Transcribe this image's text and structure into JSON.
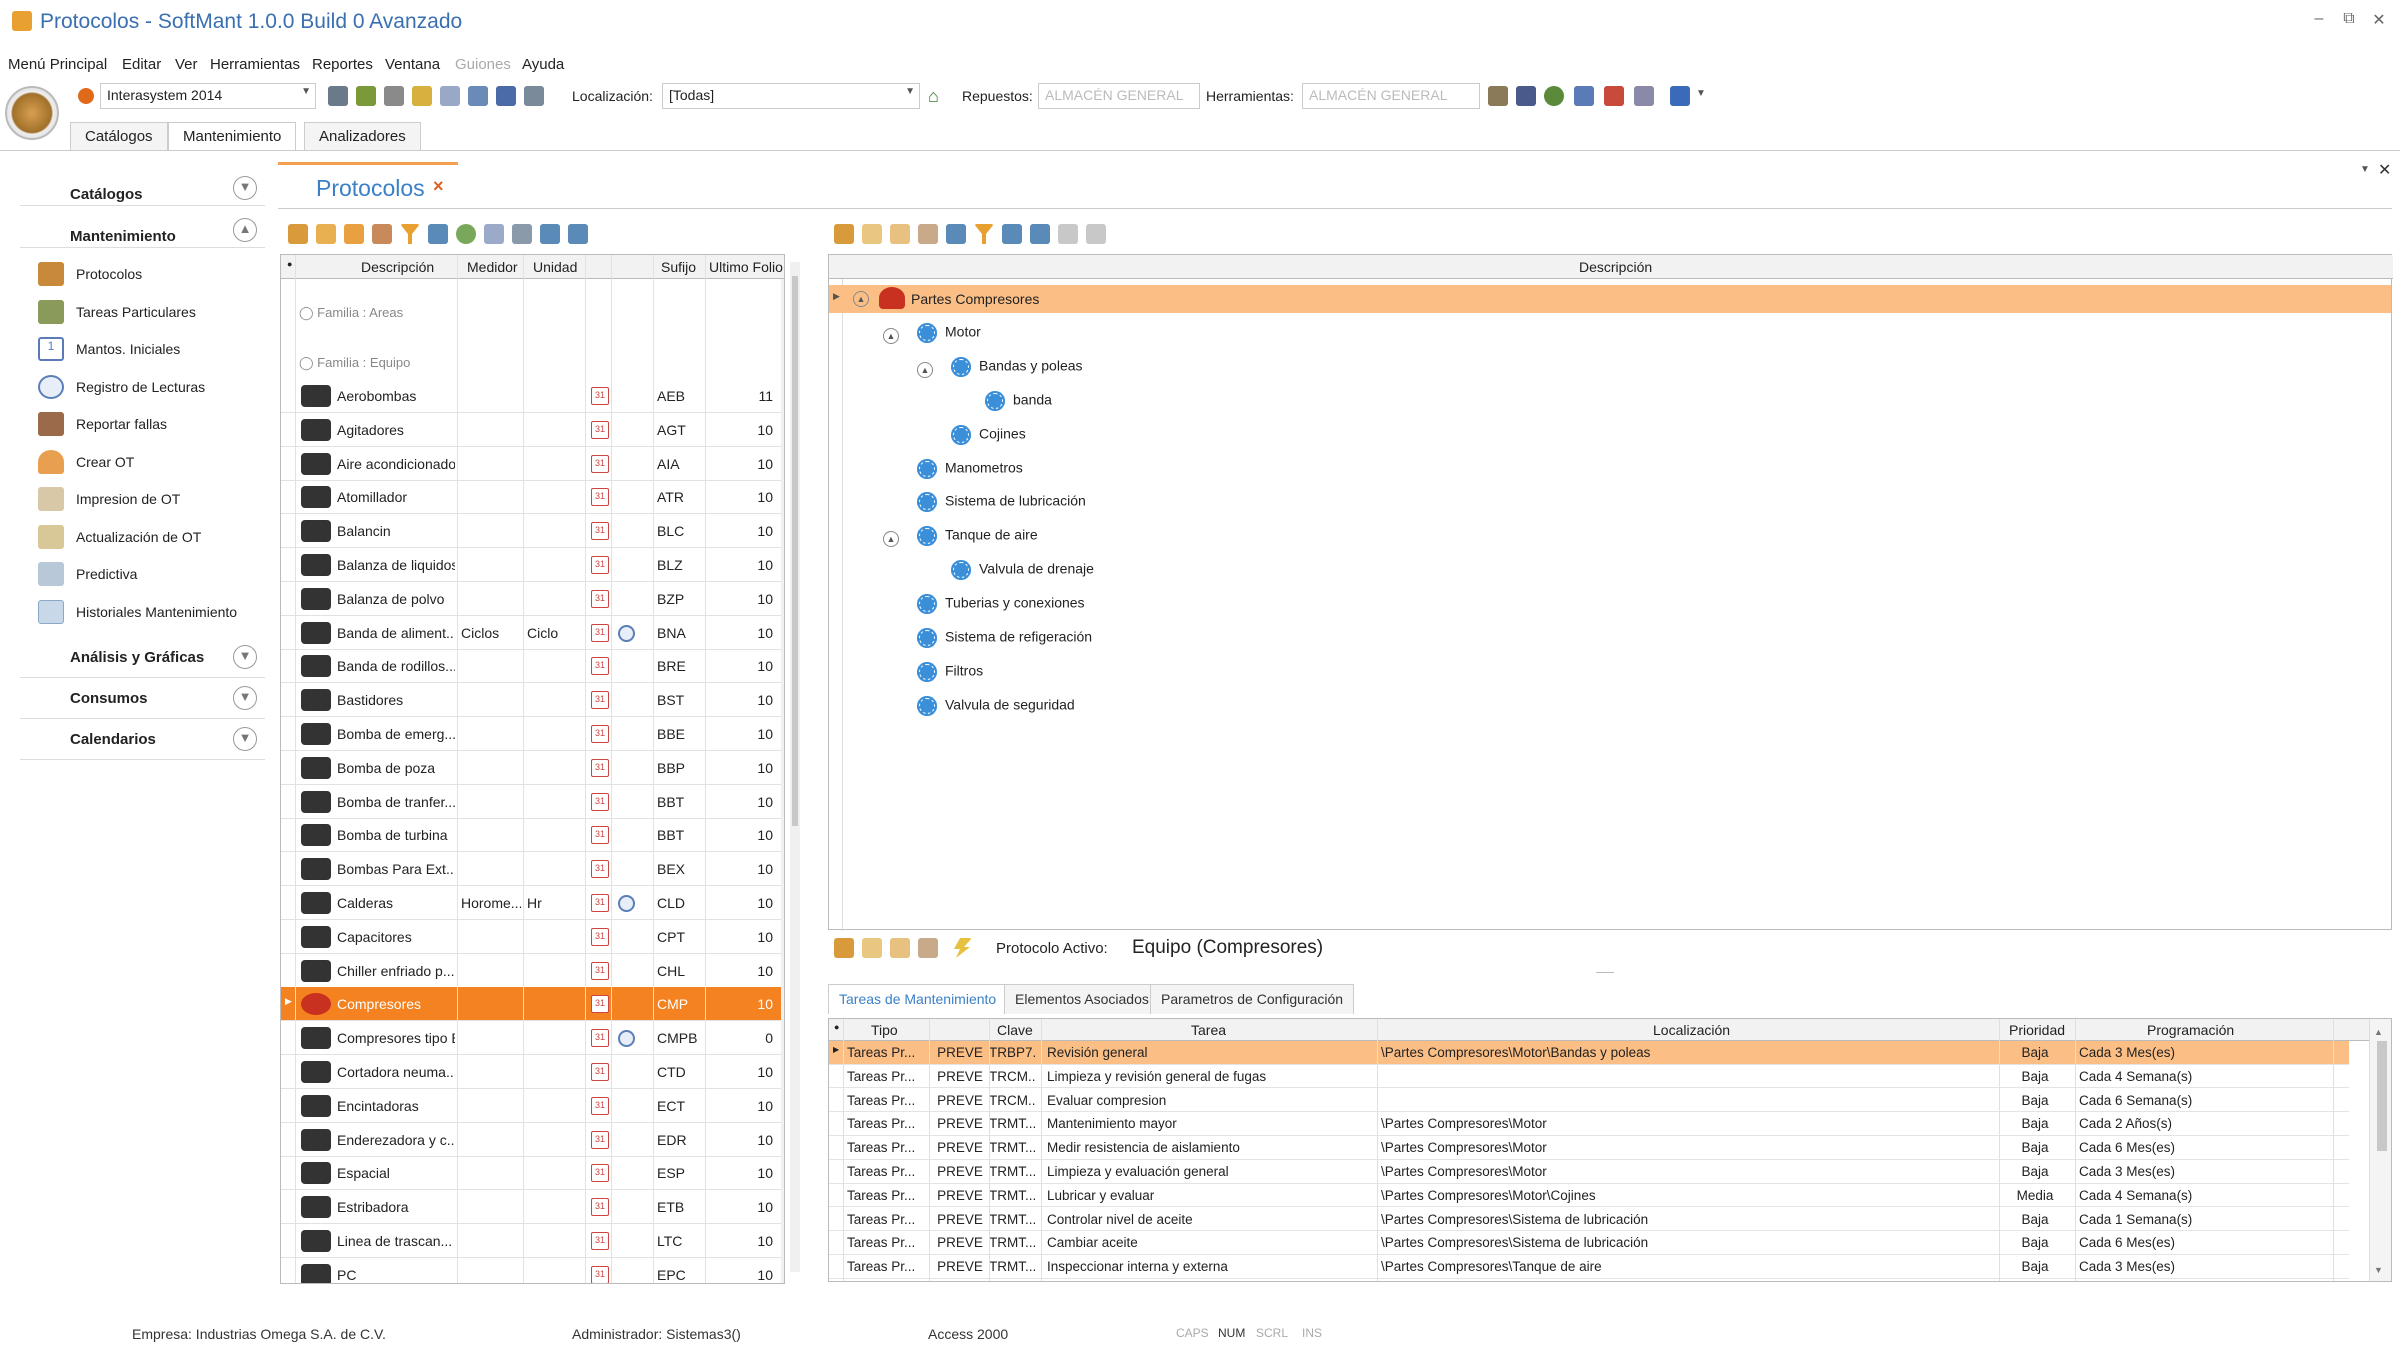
{
  "window": {
    "title": "Protocolos - SoftMant 1.0.0 Build 0 Avanzado",
    "controls": [
      "–",
      "⧉",
      "✕"
    ]
  },
  "menu": [
    "Menú Principal",
    "Editar",
    "Ver",
    "Herramientas",
    "Reportes",
    "Ventana",
    "Guiones",
    "Ayuda"
  ],
  "toolbar": {
    "company_select": "Interasystem 2014",
    "localizacion_label": "Localización:",
    "localizacion_value": "[Todas]",
    "repuestos_label": "Repuestos:",
    "repuestos_value": "ALMACÉN GENERAL",
    "herramientas_label": "Herramientas:",
    "herramientas_value": "ALMACÉN GENERAL"
  },
  "ribbon_tabs": [
    "Catálogos",
    "Mantenimiento",
    "Analizadores"
  ],
  "sidebar": {
    "groups": [
      {
        "label": "Catálogos"
      },
      {
        "label": "Mantenimiento"
      }
    ],
    "items": [
      {
        "label": "Protocolos",
        "icon": "protocol-icon"
      },
      {
        "label": "Tareas Particulares",
        "icon": "tasks-icon"
      },
      {
        "label": "Mantos. Iniciales",
        "icon": "calendar-icon"
      },
      {
        "label": "Registro de Lecturas",
        "icon": "gauge-icon"
      },
      {
        "label": "Reportar fallas",
        "icon": "report-icon"
      },
      {
        "label": "Crear OT",
        "icon": "worker-icon"
      },
      {
        "label": "Impresion de OT",
        "icon": "print-icon"
      },
      {
        "label": "Actualización de OT",
        "icon": "check-icon"
      },
      {
        "label": "Predictiva",
        "icon": "chart-icon"
      },
      {
        "label": "Historiales Mantenimiento",
        "icon": "history-icon"
      }
    ],
    "bottom_groups": [
      {
        "label": "Análisis y Gráficas"
      },
      {
        "label": "Consumos"
      },
      {
        "label": "Calendarios"
      }
    ]
  },
  "document": {
    "title": "Protocolos",
    "close": "×"
  },
  "grid": {
    "headers": [
      "Descripción",
      "Medidor",
      "Unidad",
      "Sufijo",
      "Ultimo Folio"
    ],
    "family_areas": "Familia : Areas",
    "family_equipo": "Familia : Equipo",
    "rows": [
      {
        "desc": "Aerobombas",
        "medidor": "",
        "unidad": "",
        "sufijo": "AEB",
        "folio": "11",
        "gauge": false
      },
      {
        "desc": "Agitadores",
        "medidor": "",
        "unidad": "",
        "sufijo": "AGT",
        "folio": "10",
        "gauge": false
      },
      {
        "desc": "Aire acondicionado",
        "medidor": "",
        "unidad": "",
        "sufijo": "AIA",
        "folio": "10",
        "gauge": false
      },
      {
        "desc": "Atomillador",
        "medidor": "",
        "unidad": "",
        "sufijo": "ATR",
        "folio": "10",
        "gauge": false
      },
      {
        "desc": "Balancin",
        "medidor": "",
        "unidad": "",
        "sufijo": "BLC",
        "folio": "10",
        "gauge": false
      },
      {
        "desc": "Balanza de liquidos",
        "medidor": "",
        "unidad": "",
        "sufijo": "BLZ",
        "folio": "10",
        "gauge": false
      },
      {
        "desc": "Balanza de polvo",
        "medidor": "",
        "unidad": "",
        "sufijo": "BZP",
        "folio": "10",
        "gauge": false
      },
      {
        "desc": "Banda de aliment...",
        "medidor": "Ciclos",
        "unidad": "Ciclo",
        "sufijo": "BNA",
        "folio": "10",
        "gauge": true
      },
      {
        "desc": "Banda de rodillos...",
        "medidor": "",
        "unidad": "",
        "sufijo": "BRE",
        "folio": "10",
        "gauge": false
      },
      {
        "desc": "Bastidores",
        "medidor": "",
        "unidad": "",
        "sufijo": "BST",
        "folio": "10",
        "gauge": false
      },
      {
        "desc": "Bomba de emerg...",
        "medidor": "",
        "unidad": "",
        "sufijo": "BBE",
        "folio": "10",
        "gauge": false
      },
      {
        "desc": "Bomba de poza",
        "medidor": "",
        "unidad": "",
        "sufijo": "BBP",
        "folio": "10",
        "gauge": false
      },
      {
        "desc": "Bomba de tranfer...",
        "medidor": "",
        "unidad": "",
        "sufijo": "BBT",
        "folio": "10",
        "gauge": false
      },
      {
        "desc": "Bomba de turbina",
        "medidor": "",
        "unidad": "",
        "sufijo": "BBT",
        "folio": "10",
        "gauge": false
      },
      {
        "desc": "Bombas Para Ext...",
        "medidor": "",
        "unidad": "",
        "sufijo": "BEX",
        "folio": "10",
        "gauge": false
      },
      {
        "desc": "Calderas",
        "medidor": "Horome...",
        "unidad": "Hr",
        "sufijo": "CLD",
        "folio": "10",
        "gauge": true
      },
      {
        "desc": "Capacitores",
        "medidor": "",
        "unidad": "",
        "sufijo": "CPT",
        "folio": "10",
        "gauge": false
      },
      {
        "desc": "Chiller enfriado p...",
        "medidor": "",
        "unidad": "",
        "sufijo": "CHL",
        "folio": "10",
        "gauge": false
      },
      {
        "desc": "Compresores",
        "medidor": "",
        "unidad": "",
        "sufijo": "CMP",
        "folio": "10",
        "gauge": false,
        "selected": true
      },
      {
        "desc": "Compresores tipo B",
        "medidor": "",
        "unidad": "",
        "sufijo": "CMPB",
        "folio": "0",
        "gauge": true
      },
      {
        "desc": "Cortadora neuma...",
        "medidor": "",
        "unidad": "",
        "sufijo": "CTD",
        "folio": "10",
        "gauge": false
      },
      {
        "desc": "Encintadoras",
        "medidor": "",
        "unidad": "",
        "sufijo": "ECT",
        "folio": "10",
        "gauge": false
      },
      {
        "desc": "Enderezadora y c...",
        "medidor": "",
        "unidad": "",
        "sufijo": "EDR",
        "folio": "10",
        "gauge": false
      },
      {
        "desc": "Espacial",
        "medidor": "",
        "unidad": "",
        "sufijo": "ESP",
        "folio": "10",
        "gauge": false
      },
      {
        "desc": "Estribadora",
        "medidor": "",
        "unidad": "",
        "sufijo": "ETB",
        "folio": "10",
        "gauge": false
      },
      {
        "desc": "Linea de trascan...",
        "medidor": "",
        "unidad": "",
        "sufijo": "LTC",
        "folio": "10",
        "gauge": false
      },
      {
        "desc": "PC",
        "medidor": "",
        "unidad": "",
        "sufijo": "EPC",
        "folio": "10",
        "gauge": false
      }
    ]
  },
  "tree": {
    "header": "Descripción",
    "nodes": [
      {
        "label": "Partes Compresores",
        "level": 0,
        "root": true
      },
      {
        "label": "Motor",
        "level": 1
      },
      {
        "label": "Bandas y poleas",
        "level": 2
      },
      {
        "label": "banda",
        "level": 3
      },
      {
        "label": "Cojines",
        "level": 2
      },
      {
        "label": "Manometros",
        "level": 1
      },
      {
        "label": "Sistema de lubricación",
        "level": 1
      },
      {
        "label": "Tanque de aire",
        "level": 1
      },
      {
        "label": "Valvula de drenaje",
        "level": 2
      },
      {
        "label": "Tuberias y conexiones",
        "level": 1
      },
      {
        "label": "Sistema de refigeración",
        "level": 1
      },
      {
        "label": "Filtros",
        "level": 1
      },
      {
        "label": "Valvula de seguridad",
        "level": 1
      }
    ]
  },
  "protocol_bar": {
    "label": "Protocolo Activo:",
    "value": "Equipo (Compresores)"
  },
  "bottom_tabs": [
    "Tareas de Mantenimiento",
    "Elementos Asociados",
    "Parametros de Configuración"
  ],
  "tasks": {
    "headers": [
      "Tipo",
      "Clave",
      "Tarea",
      "Localización",
      "Prioridad",
      "Programación"
    ],
    "rows": [
      {
        "tipo": "Tareas Pr...",
        "prev": "PREVE",
        "clave": "TRBP7...",
        "tarea": "Revisión general",
        "loc": "\\Partes Compresores\\Motor\\Bandas y poleas",
        "prio": "Baja",
        "prog": "Cada 3 Mes(es)",
        "selected": true
      },
      {
        "tipo": "Tareas Pr...",
        "prev": "PREVE",
        "clave": "TRCM...",
        "tarea": "Limpieza y revisión general de fugas",
        "loc": "",
        "prio": "Baja",
        "prog": "Cada 4 Semana(s)"
      },
      {
        "tipo": "Tareas Pr...",
        "prev": "PREVE",
        "clave": "TRCM...",
        "tarea": "Evaluar compresion",
        "loc": "",
        "prio": "Baja",
        "prog": "Cada 6 Semana(s)"
      },
      {
        "tipo": "Tareas Pr...",
        "prev": "PREVE",
        "clave": "TRMT...",
        "tarea": "Mantenimiento mayor",
        "loc": "\\Partes Compresores\\Motor",
        "prio": "Baja",
        "prog": "Cada 2 Años(s)"
      },
      {
        "tipo": "Tareas Pr...",
        "prev": "PREVE",
        "clave": "TRMT...",
        "tarea": "Medir resistencia de aislamiento",
        "loc": "\\Partes Compresores\\Motor",
        "prio": "Baja",
        "prog": "Cada 6 Mes(es)"
      },
      {
        "tipo": "Tareas Pr...",
        "prev": "PREVE",
        "clave": "TRMT...",
        "tarea": "Limpieza y evaluación general",
        "loc": "\\Partes Compresores\\Motor",
        "prio": "Baja",
        "prog": "Cada 3 Mes(es)"
      },
      {
        "tipo": "Tareas Pr...",
        "prev": "PREVE",
        "clave": "TRMT...",
        "tarea": "Lubricar y evaluar",
        "loc": "\\Partes Compresores\\Motor\\Cojines",
        "prio": "Media",
        "prog": "Cada 4 Semana(s)"
      },
      {
        "tipo": "Tareas Pr...",
        "prev": "PREVE",
        "clave": "TRMT...",
        "tarea": "Controlar nivel de aceite",
        "loc": "\\Partes Compresores\\Sistema de lubricación",
        "prio": "Baja",
        "prog": "Cada 1 Semana(s)"
      },
      {
        "tipo": "Tareas Pr...",
        "prev": "PREVE",
        "clave": "TRMT...",
        "tarea": "Cambiar aceite",
        "loc": "\\Partes Compresores\\Sistema de lubricación",
        "prio": "Baja",
        "prog": "Cada 6 Mes(es)"
      },
      {
        "tipo": "Tareas Pr...",
        "prev": "PREVE",
        "clave": "TRMT...",
        "tarea": "Inspeccionar interna y externa",
        "loc": "\\Partes Compresores\\Tanque de aire",
        "prio": "Baja",
        "prog": "Cada 3 Mes(es)"
      }
    ]
  },
  "status": {
    "empresa": "Empresa: Industrias Omega S.A. de C.V.",
    "admin": "Administrador: Sistemas3()",
    "db": "Access 2000",
    "caps": "CAPS",
    "num": "NUM",
    "scrl": "SCRL",
    "ins": "INS"
  },
  "colors": {
    "accent": "#f58220",
    "selected_light": "#fbbf86",
    "title_blue": "#3a6fb0",
    "gear": "#3a8fd8"
  }
}
